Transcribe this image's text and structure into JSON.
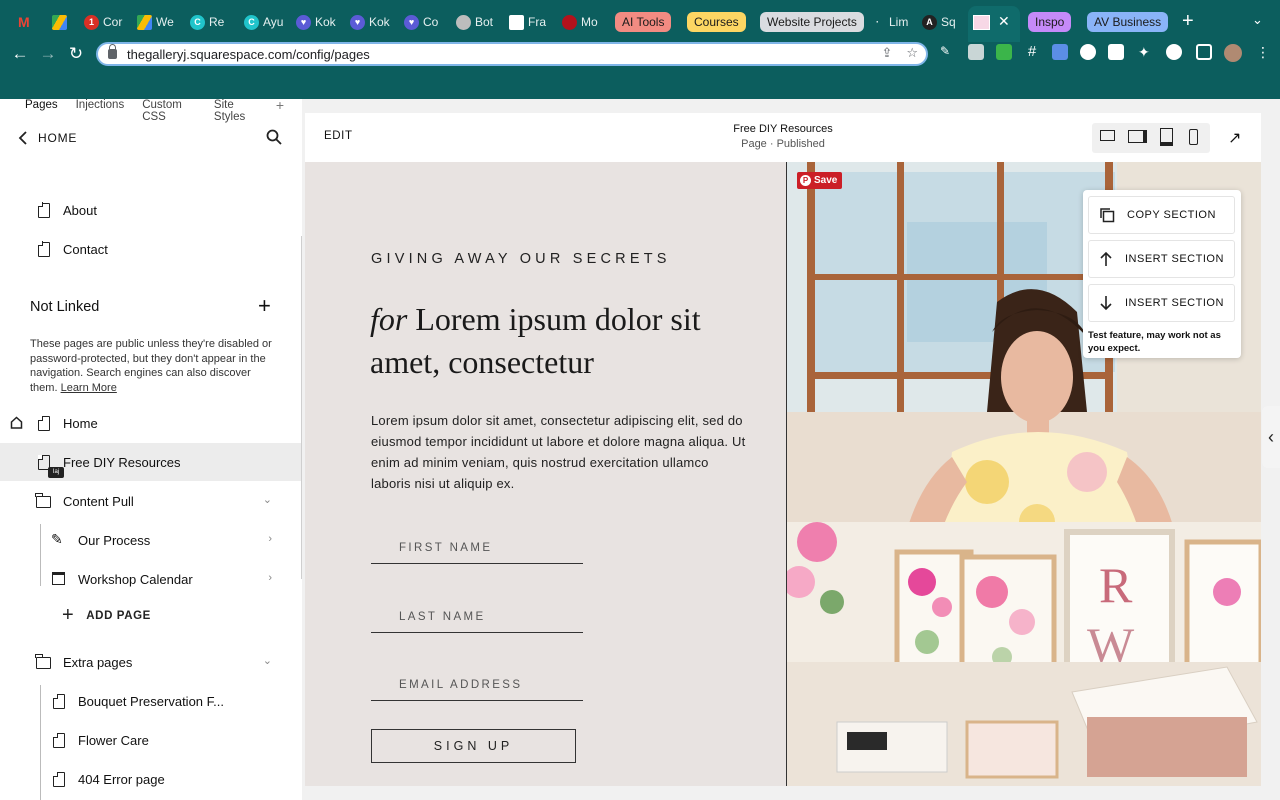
{
  "browser": {
    "tabs": [
      {
        "label": "Cor",
        "icon": "notification-badge-icon",
        "badge": "1"
      },
      {
        "label": "We",
        "icon": "drive-icon"
      },
      {
        "label": "Re",
        "icon": "canva-icon"
      },
      {
        "label": "Ayu",
        "icon": "canva-icon"
      },
      {
        "label": "Kok",
        "icon": "heart-app-icon"
      },
      {
        "label": "Kok",
        "icon": "heart-app-icon"
      },
      {
        "label": "Co",
        "icon": "heart-app-icon"
      },
      {
        "label": "Bot",
        "icon": "circle-icon"
      },
      {
        "label": "Fra",
        "icon": "document-icon"
      },
      {
        "label": "Mo",
        "icon": "red-circle-icon"
      },
      {
        "label": "Lim",
        "icon": "dot-icon"
      },
      {
        "label": "Sq",
        "icon": "a-letter-icon"
      }
    ],
    "tab_groups": [
      {
        "label": "AI Tools",
        "color": "#f28b82"
      },
      {
        "label": "Courses",
        "color": "#fdd663"
      },
      {
        "label": "Website Projects",
        "color": "#dadce0"
      },
      {
        "label": "Inspo",
        "color": "#c58af9"
      },
      {
        "label": "AV Business",
        "color": "#8ab4f8"
      }
    ],
    "active_tab_close": "✕",
    "new_tab": "+",
    "url": "thegalleryj.squarespace.com/config/pages"
  },
  "sidebar": {
    "tabs": [
      "Pages",
      "Injections",
      "Custom CSS",
      "Site Styles"
    ],
    "tab_add": "+",
    "home_label": "HOME",
    "linked_pages": [
      "About",
      "Contact"
    ],
    "not_linked": {
      "title": "Not Linked",
      "description": "These pages are public unless they're disabled or password-protected, but they don't appear in the navigation. Search engines can also discover them.",
      "learn_more": "Learn More"
    },
    "pages": {
      "home": "Home",
      "free_diy": "Free DIY Resources",
      "content_pull": "Content Pull",
      "our_process": "Our Process",
      "workshop_calendar": "Workshop Calendar",
      "add_page": "ADD PAGE",
      "extra_pages": "Extra pages",
      "bouquet": "Bouquet Preservation F...",
      "flower_care": "Flower Care",
      "error_page": "404 Error page"
    }
  },
  "editor": {
    "edit_label": "EDIT",
    "page_title": "Free DIY Resources",
    "page_status": "Page · Published",
    "device_views": [
      "desktop-icon",
      "tablet-landscape-icon",
      "tablet-portrait-icon",
      "phone-icon"
    ]
  },
  "section": {
    "kicker": "GIVING AWAY OUR SECRETS",
    "headline_italic": "for",
    "headline_rest": " Lorem ipsum dolor sit amet, consectetur",
    "body": "Lorem ipsum dolor sit amet, consectetur adipiscing elit, sed do eiusmod tempor incididunt ut labore et dolore magna aliqua. Ut enim ad minim veniam, quis nostrud exercitation ullamco laboris nisi ut aliquip ex.",
    "fields": [
      "FIRST NAME",
      "LAST NAME",
      "EMAIL ADDRESS"
    ],
    "signup_label": "SIGN UP",
    "pin_save": "Save",
    "menu": {
      "copy": "COPY SECTION",
      "insert_above": "INSERT SECTION",
      "insert_below": "INSERT SECTION",
      "note": "Test feature, may work not as you expect."
    },
    "frame_letters": [
      "R",
      "W"
    ]
  },
  "colors": {
    "chrome": "#0c5e5e",
    "canvas_bg": "#e8e3e1",
    "pinterest": "#cb1f27"
  }
}
